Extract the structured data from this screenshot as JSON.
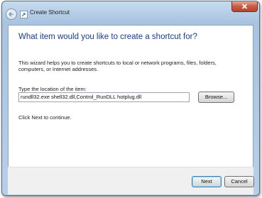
{
  "window": {
    "title": "Create Shortcut"
  },
  "wizard": {
    "heading": "What item would you like to create a shortcut for?",
    "description": "This wizard helps you to create shortcuts to local or network programs, files, folders, computers, or Internet addresses.",
    "location_label": "Type the location of the item:",
    "location_value": "rundll32.exe shell32.dll,Control_RunDLL hotplug.dll",
    "browse_label": "Browse...",
    "continue_text": "Click Next to continue."
  },
  "footer": {
    "next_label": "Next",
    "cancel_label": "Cancel"
  },
  "icons": {
    "back": "back-arrow-icon",
    "wizard": "shortcut-wizard-icon",
    "close": "close-icon"
  },
  "colors": {
    "heading": "#1a3c8c",
    "close_button": "#c75b44"
  }
}
